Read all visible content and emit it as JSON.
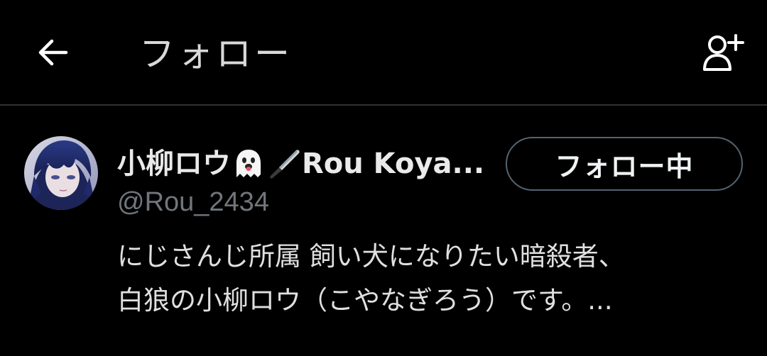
{
  "header": {
    "title": "フォロー",
    "back_icon": "arrow-left-icon",
    "add_icon": "add-user-icon"
  },
  "user": {
    "display_name_prefix": "小柳ロウ",
    "emoji_1": "ghost-emoji",
    "emoji_2": "knife-emoji",
    "display_name_suffix": "Rou Koya...",
    "handle": "@Rou_2434",
    "follow_button_label": "フォロー中",
    "bio_line_1": "にじさんじ所属 飼い犬になりたい暗殺者、",
    "bio_line_2": "白狼の小柳ロウ（こやなぎろう）です。..."
  },
  "colors": {
    "background": "#000000",
    "text_primary": "#e7e9ea",
    "text_secondary": "#71767b",
    "divider": "#2f3336",
    "button_border": "#536471"
  }
}
